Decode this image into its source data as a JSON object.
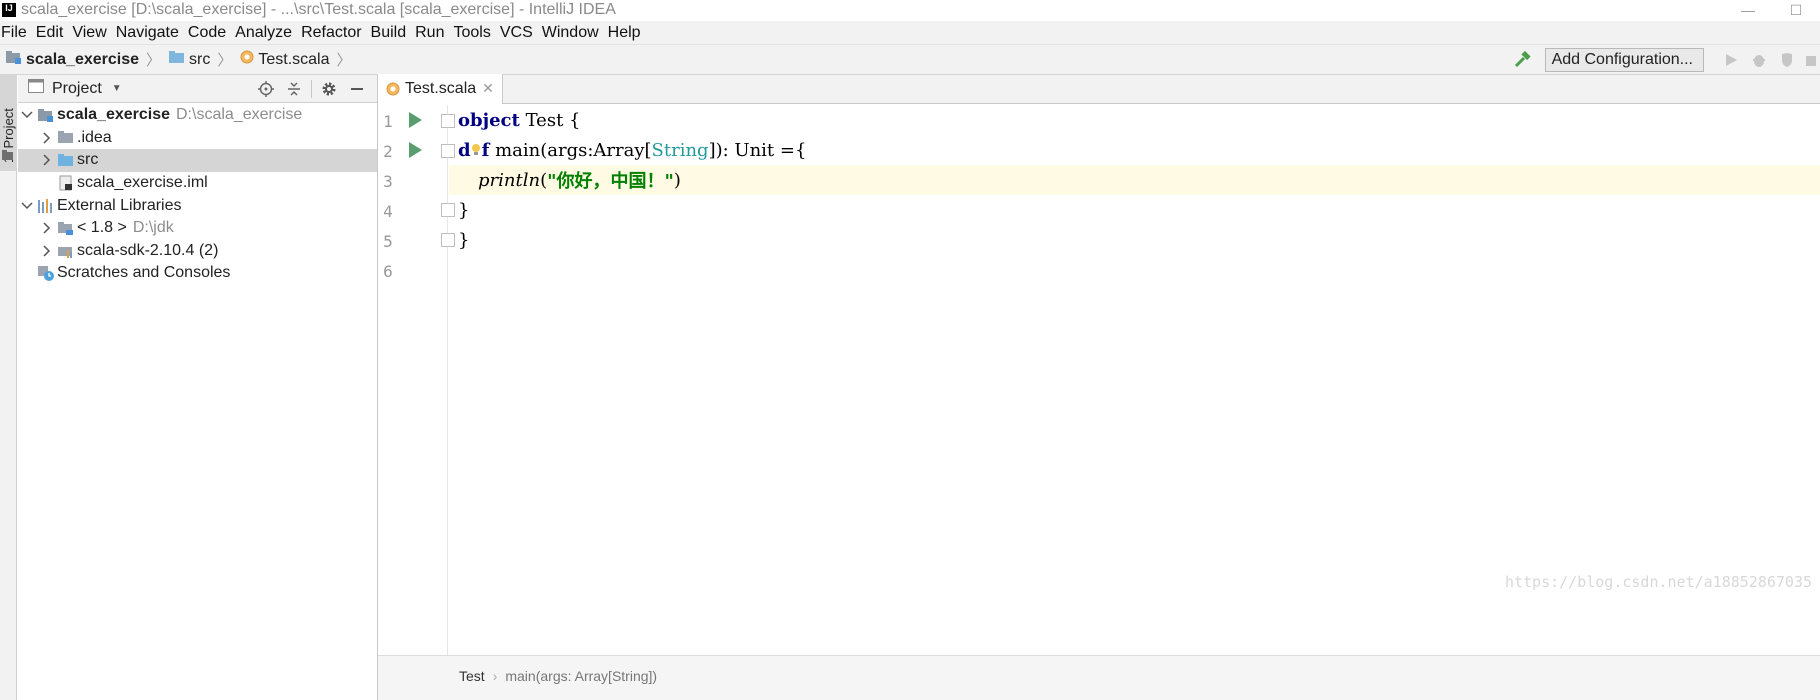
{
  "window": {
    "title": "scala_exercise [D:\\scala_exercise] - ...\\src\\Test.scala [scala_exercise] - IntelliJ IDEA",
    "logo_text": "IJ"
  },
  "menu": [
    "File",
    "Edit",
    "View",
    "Navigate",
    "Code",
    "Analyze",
    "Refactor",
    "Build",
    "Run",
    "Tools",
    "VCS",
    "Window",
    "Help"
  ],
  "navbar": {
    "crumbs": [
      "scala_exercise",
      "src",
      "Test.scala"
    ],
    "add_configuration": "Add Configuration..."
  },
  "left_strip": {
    "label": "1: Project"
  },
  "project_panel": {
    "title": "Project",
    "tree": [
      {
        "label": "scala_exercise",
        "path": "D:\\scala_exercise"
      },
      {
        "label": ".idea"
      },
      {
        "label": "src"
      },
      {
        "label": "scala_exercise.iml"
      },
      {
        "label": "External Libraries"
      },
      {
        "label": "< 1.8 >",
        "path": "D:\\jdk"
      },
      {
        "label": "scala-sdk-2.10.4 (2)"
      },
      {
        "label": "Scratches and Consoles"
      }
    ]
  },
  "editor": {
    "tab_label": "Test.scala",
    "line_numbers": [
      "1",
      "2",
      "3",
      "4",
      "5",
      "6"
    ],
    "code": {
      "l1_kw": "object",
      "l1_rest": " Test {",
      "l2_kw_d": "d",
      "l2_kw_f": "f",
      "l2_rest1": " main(args:Array[",
      "l2_type": "String",
      "l2_rest2": "]): Unit ={",
      "l3_fn": "println",
      "l3_open": "(",
      "l3_str": "\"你好，中国！\"",
      "l3_close": ")",
      "l4": "}",
      "l5": "}"
    },
    "breadcrumb": [
      "Test",
      "main(args: Array[String])"
    ]
  },
  "watermark": "https://blog.csdn.net/a18852867035",
  "colors": {
    "run_green": "#5a9e6f",
    "keyword": "#000080",
    "string": "#008000",
    "type": "#20999d",
    "current_line": "#fffae3"
  }
}
